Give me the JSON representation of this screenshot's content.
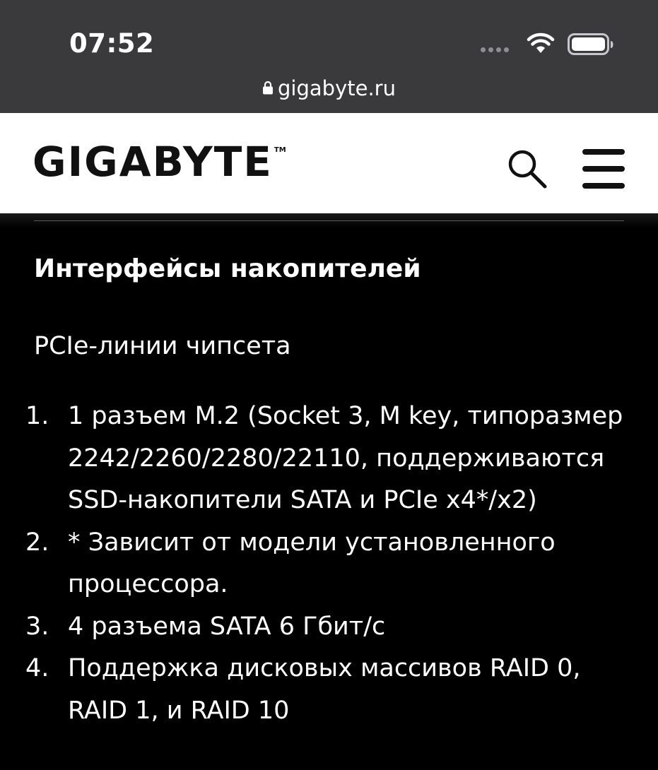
{
  "status_bar": {
    "time": "07:52",
    "icons": [
      "signal-dots-icon",
      "wifi-icon",
      "battery-icon"
    ]
  },
  "browser": {
    "url": "gigabyte.ru"
  },
  "header": {
    "logo_text": "GIGABYTE",
    "logo_tm": "TM",
    "icons": [
      "search-icon",
      "menu-icon"
    ]
  },
  "content": {
    "section_title": "Интерфейсы накопителей",
    "subheading": "PCIe-линии чипсета",
    "items": [
      {
        "num": "1.",
        "text": "1 разъем M.2 (Socket 3, M key, типоразмер 2242/2260/2280/22110, поддерживаются SSD-накопители SATA и PCIe x4*/x2)"
      },
      {
        "num": "2.",
        "text": "* Зависит от модели установленного процессора."
      },
      {
        "num": "3.",
        "text": "4 разъема SATA 6 Гбит/с"
      },
      {
        "num": "4.",
        "text": "Поддержка дисковых массивов RAID 0, RAID 1, и RAID 10"
      }
    ]
  },
  "colors": {
    "status_bar_bg": "#3a3a3c",
    "header_bg": "#ffffff",
    "page_bg": "#000000",
    "text": "#ffffff"
  }
}
